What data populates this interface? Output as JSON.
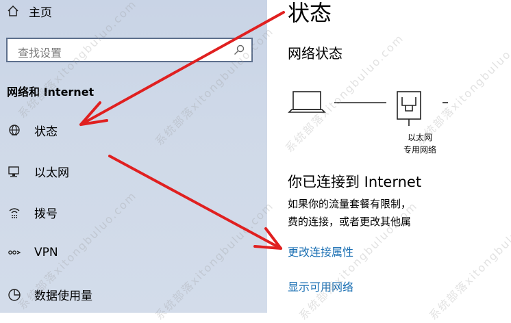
{
  "sidebar": {
    "home_label": "主页",
    "search_placeholder": "查找设置",
    "section_title": "网络和 Internet",
    "items": [
      {
        "label": "状态",
        "icon": "globe-icon"
      },
      {
        "label": "以太网",
        "icon": "ethernet-icon"
      },
      {
        "label": "拨号",
        "icon": "dialup-icon"
      },
      {
        "label": "VPN",
        "icon": "vpn-icon"
      },
      {
        "label": "数据使用量",
        "icon": "data-usage-icon"
      }
    ]
  },
  "main": {
    "title": "状态",
    "section_heading": "网络状态",
    "ethernet_label_line1": "以太网",
    "ethernet_label_line2": "专用网络",
    "connected_heading": "你已连接到 Internet",
    "desc_line1": "如果你的流量套餐有限制，",
    "desc_line2": "费的连接，或者更改其他属",
    "links": {
      "change_properties": "更改连接属性",
      "show_networks": "显示可用网络"
    }
  },
  "watermark": "系统部落xitongbuluo.com",
  "colors": {
    "link": "#1a6fb3",
    "annotation_arrow": "#e02020",
    "sidebar_bg": "#ccd6e7"
  }
}
